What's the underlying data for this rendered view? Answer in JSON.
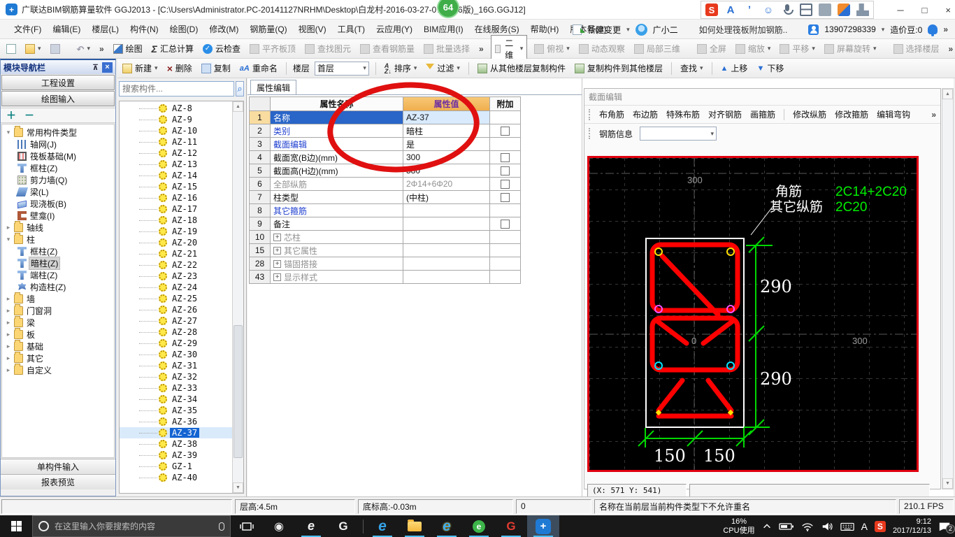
{
  "title_bar": {
    "app_title": "广联达BIM钢筋算量软件 GGJ2013 - [C:\\Users\\Administrator.PC-20141127NRHM\\Desktop\\白龙村-2016-03-27-07(2166版)_16G.GGJ12]",
    "badge": "64",
    "minimize": "─",
    "maximize": "□",
    "close": "×"
  },
  "sogou_bar": {
    "icons": [
      {
        "g": "S",
        "cls": "s-s",
        "name": "sogou-logo-icon"
      },
      {
        "g": "A",
        "cls": "s-a",
        "name": "font-mode-icon"
      },
      {
        "g": "ʼ",
        "cls": "s-pen",
        "name": "handwriting-icon"
      },
      {
        "g": "☺",
        "cls": "s-emoji",
        "name": "emoji-icon"
      },
      {
        "g": "",
        "cls": "s-mic",
        "name": "voice-input-icon"
      },
      {
        "g": "",
        "cls": "s-kbd",
        "name": "soft-keyboard-icon"
      },
      {
        "g": "",
        "cls": "s-skin",
        "name": "skin-icon"
      },
      {
        "g": "",
        "cls": "s-shirt",
        "name": "dress-icon"
      },
      {
        "g": "",
        "cls": "s-wrench",
        "name": "toolbox-icon"
      }
    ]
  },
  "menu": {
    "items": [
      "文件(F)",
      "编辑(E)",
      "楼层(L)",
      "构件(N)",
      "绘图(D)",
      "修改(M)",
      "钢筋量(Q)",
      "视图(V)",
      "工具(T)",
      "云应用(Y)",
      "BIM应用(I)",
      "在线服务(S)",
      "帮助(H)",
      "版本号(B)"
    ],
    "new_change": "新建变更",
    "assistant": "广小二",
    "qa_text": "如何处理筏板附加钢筋..",
    "phone": "13907298339",
    "beans": "造价豆:0"
  },
  "toolbar1": {
    "draw": "绘图",
    "sum_calc": "汇总计算",
    "cloud_check": "云检查",
    "align_slab_top": "平齐板顶",
    "find_element": "查找图元",
    "view_rebar": "查看钢筋量",
    "batch_select": "批量选择",
    "view_mode": "二维",
    "top_view": "俯视",
    "orbit": "动态观察",
    "local_3d": "局部三维",
    "full_screen": "全屏",
    "zoom": "缩放",
    "pan": "平移",
    "screen_rotate": "屏幕旋转",
    "select_floor": "选择楼层"
  },
  "toolbar2": {
    "new": "新建",
    "del": "删除",
    "copy": "复制",
    "rename": "重命名",
    "floor_label": "楼层",
    "floor_value": "首层",
    "sort": "排序",
    "filter": "过滤",
    "copy_from_other": "从其他楼层复制构件",
    "copy_to_other": "复制构件到其他楼层",
    "find": "查找",
    "move_up": "上移",
    "move_down": "下移"
  },
  "sidebar": {
    "title": "模块导航栏",
    "btn_project": "工程设置",
    "btn_draw": "绘图输入",
    "btn_single": "单构件输入",
    "btn_report": "报表预览",
    "tree": [
      {
        "label": "常用构件类型",
        "arrow": "▾",
        "icon": "i-folder",
        "cls": "d0"
      },
      {
        "label": "轴网(J)",
        "icon": "i-axis",
        "cls": "d1"
      },
      {
        "label": "筏板基础(M)",
        "icon": "i-raft",
        "cls": "d1"
      },
      {
        "label": "框柱(Z)",
        "icon": "i-col",
        "cls": "d1"
      },
      {
        "label": "剪力墙(Q)",
        "icon": "i-wall",
        "cls": "d1"
      },
      {
        "label": "梁(L)",
        "icon": "i-beam",
        "cls": "d1"
      },
      {
        "label": "现浇板(B)",
        "icon": "i-slab",
        "cls": "d1"
      },
      {
        "label": "壁龛(I)",
        "icon": "i-niche",
        "cls": "d1"
      },
      {
        "label": "轴线",
        "arrow": "▸",
        "icon": "i-folder",
        "cls": "d0"
      },
      {
        "label": "柱",
        "arrow": "▾",
        "icon": "i-folder",
        "cls": "d0"
      },
      {
        "label": "框柱(Z)",
        "icon": "i-col",
        "cls": "d1"
      },
      {
        "label": "暗柱(Z)",
        "icon": "i-col",
        "cls": "d1 sel"
      },
      {
        "label": "端柱(Z)",
        "icon": "i-col",
        "cls": "d1"
      },
      {
        "label": "构造柱(Z)",
        "icon": "i-colc",
        "cls": "d1"
      },
      {
        "label": "墙",
        "arrow": "▸",
        "icon": "i-folder",
        "cls": "d0"
      },
      {
        "label": "门窗洞",
        "arrow": "▸",
        "icon": "i-folder",
        "cls": "d0"
      },
      {
        "label": "梁",
        "arrow": "▸",
        "icon": "i-folder",
        "cls": "d0"
      },
      {
        "label": "板",
        "arrow": "▸",
        "icon": "i-folder",
        "cls": "d0"
      },
      {
        "label": "基础",
        "arrow": "▸",
        "icon": "i-folder",
        "cls": "d0"
      },
      {
        "label": "其它",
        "arrow": "▸",
        "icon": "i-folder",
        "cls": "d0"
      },
      {
        "label": "自定义",
        "arrow": "▸",
        "icon": "i-folder",
        "cls": "d0"
      }
    ]
  },
  "component_list": {
    "search_placeholder": "搜索构件...",
    "items": [
      {
        "label": "AZ-8"
      },
      {
        "label": "AZ-9"
      },
      {
        "label": "AZ-10"
      },
      {
        "label": "AZ-11"
      },
      {
        "label": "AZ-12"
      },
      {
        "label": "AZ-13"
      },
      {
        "label": "AZ-14"
      },
      {
        "label": "AZ-15"
      },
      {
        "label": "AZ-16"
      },
      {
        "label": "AZ-17"
      },
      {
        "label": "AZ-18"
      },
      {
        "label": "AZ-19"
      },
      {
        "label": "AZ-20"
      },
      {
        "label": "AZ-21"
      },
      {
        "label": "AZ-22"
      },
      {
        "label": "AZ-23"
      },
      {
        "label": "AZ-24"
      },
      {
        "label": "AZ-25"
      },
      {
        "label": "AZ-26"
      },
      {
        "label": "AZ-27"
      },
      {
        "label": "AZ-28"
      },
      {
        "label": "AZ-29"
      },
      {
        "label": "AZ-30"
      },
      {
        "label": "AZ-31"
      },
      {
        "label": "AZ-32"
      },
      {
        "label": "AZ-33"
      },
      {
        "label": "AZ-34"
      },
      {
        "label": "AZ-35"
      },
      {
        "label": "AZ-36"
      },
      {
        "label": "AZ-37",
        "cls": "sel"
      },
      {
        "label": "AZ-38"
      },
      {
        "label": "AZ-39"
      },
      {
        "label": "GZ-1"
      },
      {
        "label": "AZ-40"
      }
    ]
  },
  "properties": {
    "tab": "属性编辑",
    "col_name": "属性名称",
    "col_value": "属性值",
    "col_attach": "附加",
    "rows": [
      {
        "num": "1",
        "name": "名称",
        "value": "AZ-37",
        "rcls": "r-sel"
      },
      {
        "num": "2",
        "name": "类别",
        "value": "暗柱",
        "ncls": "link",
        "check": "box"
      },
      {
        "num": "3",
        "name": "截面编辑",
        "value": "是",
        "ncls": "link"
      },
      {
        "num": "4",
        "name": "截面宽(B边)(mm)",
        "value": "300",
        "check": "box"
      },
      {
        "num": "5",
        "name": "截面高(H边)(mm)",
        "value": "580",
        "check": "box"
      },
      {
        "num": "6",
        "name": "全部纵筋",
        "value": "2Φ14+6Φ20",
        "ncls": "dim",
        "vcls": "dim",
        "check": "box"
      },
      {
        "num": "7",
        "name": "柱类型",
        "value": "(中柱)",
        "check": "box"
      },
      {
        "num": "8",
        "name": "其它箍筋",
        "value": "",
        "ncls": "link"
      },
      {
        "num": "9",
        "name": "备注",
        "value": "",
        "check": "box"
      },
      {
        "num": "10",
        "name": "芯柱",
        "value": "",
        "ncls": "dim",
        "plus": "show"
      },
      {
        "num": "15",
        "name": "其它属性",
        "value": "",
        "ncls": "dim",
        "plus": "show"
      },
      {
        "num": "28",
        "name": "锚固搭接",
        "value": "",
        "ncls": "dim",
        "plus": "show"
      },
      {
        "num": "43",
        "name": "显示样式",
        "value": "",
        "ncls": "dim",
        "plus": "show"
      }
    ]
  },
  "section_editor": {
    "title": "截面编辑",
    "tools": [
      {
        "label": "布角筋"
      },
      {
        "label": "布边筋"
      },
      {
        "label": "特殊布筋"
      },
      {
        "label": "对齐钢筋"
      },
      {
        "label": "画箍筋"
      },
      {
        "label": "",
        "cls": "sep"
      },
      {
        "label": "修改纵筋"
      },
      {
        "label": "修改箍筋"
      },
      {
        "label": "编辑弯钩"
      }
    ],
    "rebar_info_label": "钢筋信息",
    "coords": "(X: 571 Y: 541)",
    "canvas": {
      "grid_top": "300",
      "grid_zero": "0",
      "grid_right": "300",
      "dim_r1": "290",
      "dim_r2": "290",
      "dim_b1": "150",
      "dim_b2": "150",
      "lbl_corner": "角筋",
      "lbl_other": "其它纵筋",
      "val_corner": "2C14+2C20",
      "val_other": "2C20",
      "rebar_color": "#ff0000",
      "dim_color": "#00d800",
      "value_color": "#00ee00"
    }
  },
  "status_bar": {
    "cell1": "",
    "cell2": "层高:4.5m",
    "cell3": "底标高:-0.03m",
    "cell4": "0",
    "cell5": "名称在当前层当前构件类型下不允许重名",
    "fps": "210.1 FPS"
  },
  "taskbar": {
    "search_placeholder": "在这里输入你要搜索的内容",
    "apps": [
      {
        "g": "◉",
        "cls": "a-pin",
        "name": "pinwheel-app-icon"
      },
      {
        "g": "e",
        "cls": "a-ew run",
        "name": "ie-white-icon"
      },
      {
        "g": "G",
        "cls": "a-gs",
        "name": "g-spiral-app-icon"
      },
      {
        "g": "",
        "cls": "a-sep",
        "name": "taskbar-separator"
      },
      {
        "g": "e",
        "cls": "a-edge run",
        "name": "edge-icon"
      },
      {
        "g": "",
        "cls": "a-folder run",
        "name": "file-explorer-icon"
      },
      {
        "g": "e",
        "cls": "a-ie run",
        "name": "internet-explorer-icon"
      },
      {
        "g": "e",
        "cls": "a-360 run",
        "name": "360-browser-icon"
      },
      {
        "g": "G",
        "cls": "a-gred run",
        "name": "glodon-g-icon"
      },
      {
        "g": "+",
        "cls": "a-ggj run active",
        "name": "ggj-app-icon"
      }
    ],
    "cpu_pct": "16%",
    "cpu_label": "CPU使用",
    "lang": "A",
    "ime": "S",
    "time": "9:12",
    "date": "2017/12/13",
    "notif_count": "2"
  }
}
